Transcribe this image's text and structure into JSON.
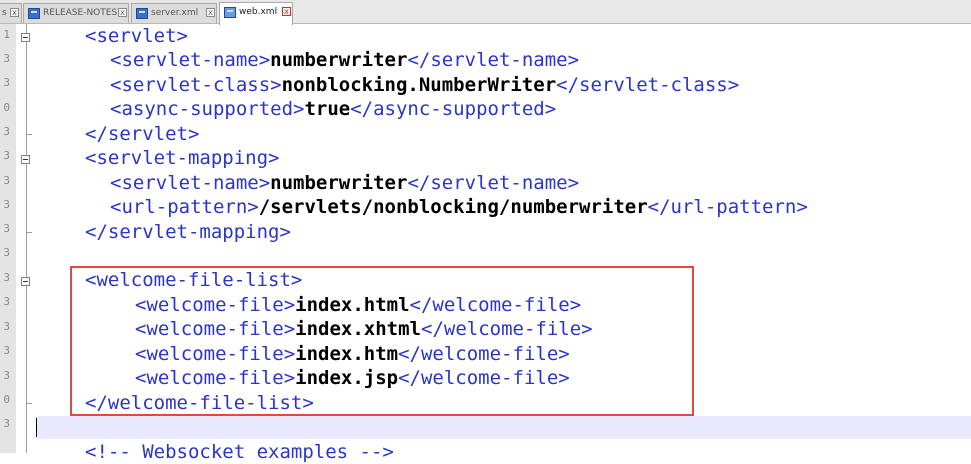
{
  "tabs": [
    {
      "label": "s",
      "active": false
    },
    {
      "label": "RELEASE-NOTES",
      "active": false
    },
    {
      "label": "server.xml",
      "active": false
    },
    {
      "label": "web.xml",
      "active": true
    }
  ],
  "tab_close_glyph": "x",
  "gutter_numbers": [
    "1",
    "3",
    "3",
    "0",
    "3",
    "3",
    "3",
    "3",
    "3",
    "3",
    "3",
    "3",
    "3",
    "3",
    "3",
    "0",
    "3"
  ],
  "code": {
    "l1_open": "<servlet>",
    "l2_open": "<servlet-name>",
    "l2_val": "numberwriter",
    "l2_close": "</servlet-name>",
    "l3_open": "<servlet-class>",
    "l3_val": "nonblocking.NumberWriter",
    "l3_close": "</servlet-class>",
    "l4_open": "<async-supported>",
    "l4_val": "true",
    "l4_close": "</async-supported>",
    "l5_close": "</servlet>",
    "l6_open": "<servlet-mapping>",
    "l7_open": "<servlet-name>",
    "l7_val": "numberwriter",
    "l7_close": "</servlet-name>",
    "l8_open": "<url-pattern>",
    "l8_val": "/servlets/nonblocking/numberwriter",
    "l8_close": "</url-pattern>",
    "l9_close": "</servlet-mapping>",
    "l11_open": "<welcome-file-list>",
    "l12_open": "<welcome-file>",
    "l12_val": "index.html",
    "l12_close": "</welcome-file>",
    "l13_open": "<welcome-file>",
    "l13_val": "index.xhtml",
    "l13_close": "</welcome-file>",
    "l14_open": "<welcome-file>",
    "l14_val": "index.htm",
    "l14_close": "</welcome-file>",
    "l15_open": "<welcome-file>",
    "l15_val": "index.jsp",
    "l15_close": "</welcome-file>",
    "l16_close": "</welcome-file-list>",
    "l18_comment": "<!-- Websocket examples -->"
  },
  "colors": {
    "tag": "#2a34c8",
    "value": "#000000",
    "highlight_border": "#e04848",
    "current_line": "#e8e8ff"
  }
}
